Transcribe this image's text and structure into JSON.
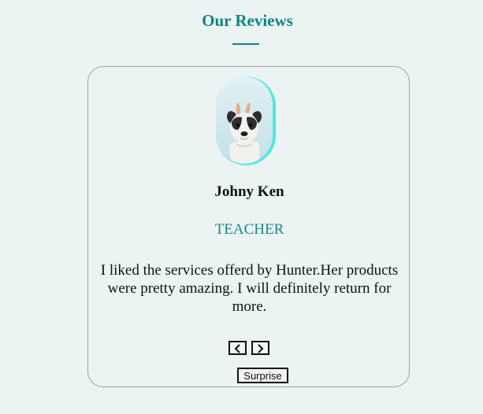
{
  "section": {
    "title": "Our Reviews"
  },
  "review": {
    "name": "Johny Ken",
    "role": "TEACHER",
    "text": "I liked the services offerd by Hunter.Her products were pretty amazing. I will definitely return for more."
  },
  "controls": {
    "prev_icon": "chevron-left-icon",
    "next_icon": "chevron-right-icon",
    "surprise_label": "Surprise"
  },
  "colors": {
    "accent": "#0f8486",
    "role": "#1a8a8c",
    "avatar_ring": "#4ee8e2",
    "background": "#ebf4f3"
  }
}
